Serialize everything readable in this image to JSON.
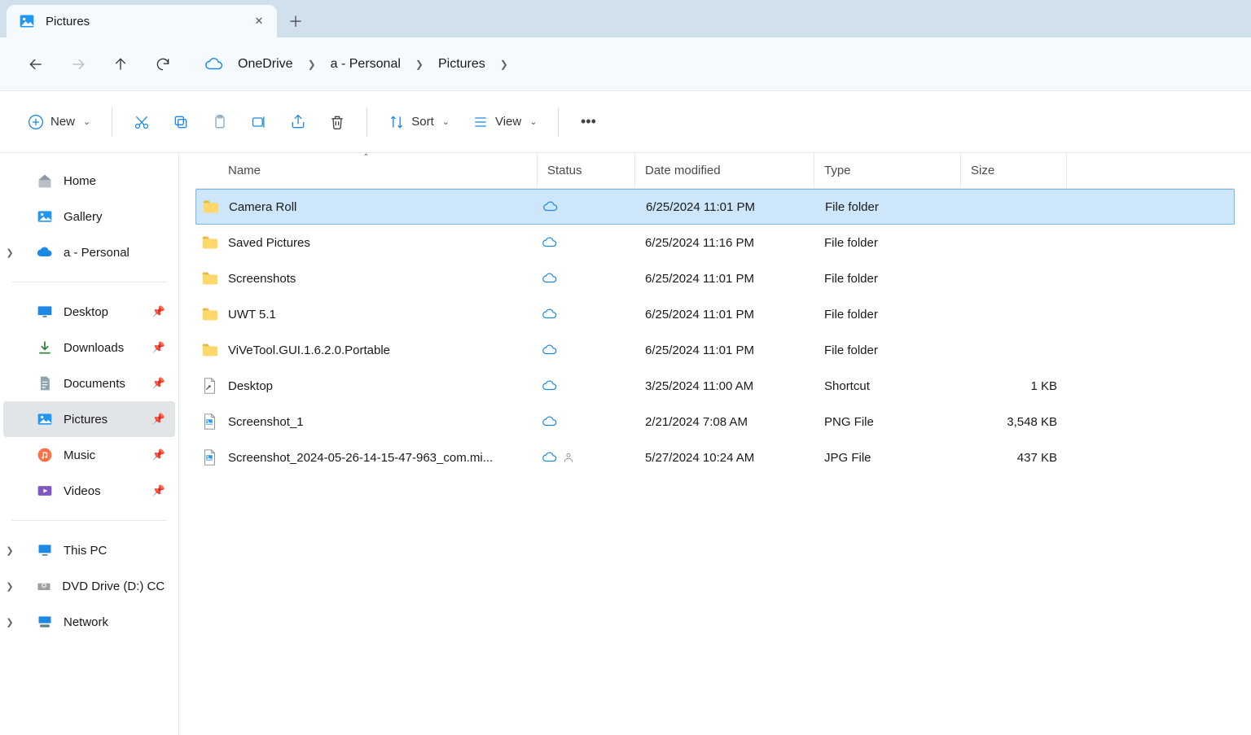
{
  "tab": {
    "title": "Pictures"
  },
  "breadcrumb": [
    "OneDrive",
    "a - Personal",
    "Pictures"
  ],
  "toolbar": {
    "new_label": "New",
    "sort_label": "Sort",
    "view_label": "View"
  },
  "columns": {
    "name": "Name",
    "status": "Status",
    "date": "Date modified",
    "type": "Type",
    "size": "Size"
  },
  "sidebar": {
    "top": [
      {
        "label": "Home",
        "icon": "home"
      },
      {
        "label": "Gallery",
        "icon": "gallery"
      },
      {
        "label": "a - Personal",
        "icon": "onedrive",
        "expandable": true
      }
    ],
    "quick": [
      {
        "label": "Desktop",
        "icon": "desktop"
      },
      {
        "label": "Downloads",
        "icon": "downloads"
      },
      {
        "label": "Documents",
        "icon": "documents"
      },
      {
        "label": "Pictures",
        "icon": "pictures",
        "selected": true
      },
      {
        "label": "Music",
        "icon": "music"
      },
      {
        "label": "Videos",
        "icon": "videos"
      }
    ],
    "bottom": [
      {
        "label": "This PC",
        "icon": "pc",
        "expandable": true
      },
      {
        "label": "DVD Drive (D:) CCC",
        "icon": "dvd",
        "expandable": true
      },
      {
        "label": "Network",
        "icon": "network",
        "expandable": true
      }
    ]
  },
  "files": [
    {
      "name": "Camera Roll",
      "icon": "folder",
      "status": "cloud",
      "date": "6/25/2024 11:01 PM",
      "type": "File folder",
      "size": "",
      "selected": true
    },
    {
      "name": "Saved Pictures",
      "icon": "folder",
      "status": "cloud",
      "date": "6/25/2024 11:16 PM",
      "type": "File folder",
      "size": ""
    },
    {
      "name": "Screenshots",
      "icon": "folder",
      "status": "cloud",
      "date": "6/25/2024 11:01 PM",
      "type": "File folder",
      "size": ""
    },
    {
      "name": "UWT 5.1",
      "icon": "folder",
      "status": "cloud",
      "date": "6/25/2024 11:01 PM",
      "type": "File folder",
      "size": ""
    },
    {
      "name": "ViVeTool.GUI.1.6.2.0.Portable",
      "icon": "folder",
      "status": "cloud",
      "date": "6/25/2024 11:01 PM",
      "type": "File folder",
      "size": ""
    },
    {
      "name": "Desktop",
      "icon": "shortcut",
      "status": "cloud",
      "date": "3/25/2024 11:00 AM",
      "type": "Shortcut",
      "size": "1 KB"
    },
    {
      "name": "Screenshot_1",
      "icon": "image",
      "status": "cloud",
      "date": "2/21/2024 7:08 AM",
      "type": "PNG File",
      "size": "3,548 KB"
    },
    {
      "name": "Screenshot_2024-05-26-14-15-47-963_com.mi...",
      "icon": "image",
      "status": "cloud-shared",
      "date": "5/27/2024 10:24 AM",
      "type": "JPG File",
      "size": "437 KB"
    }
  ]
}
